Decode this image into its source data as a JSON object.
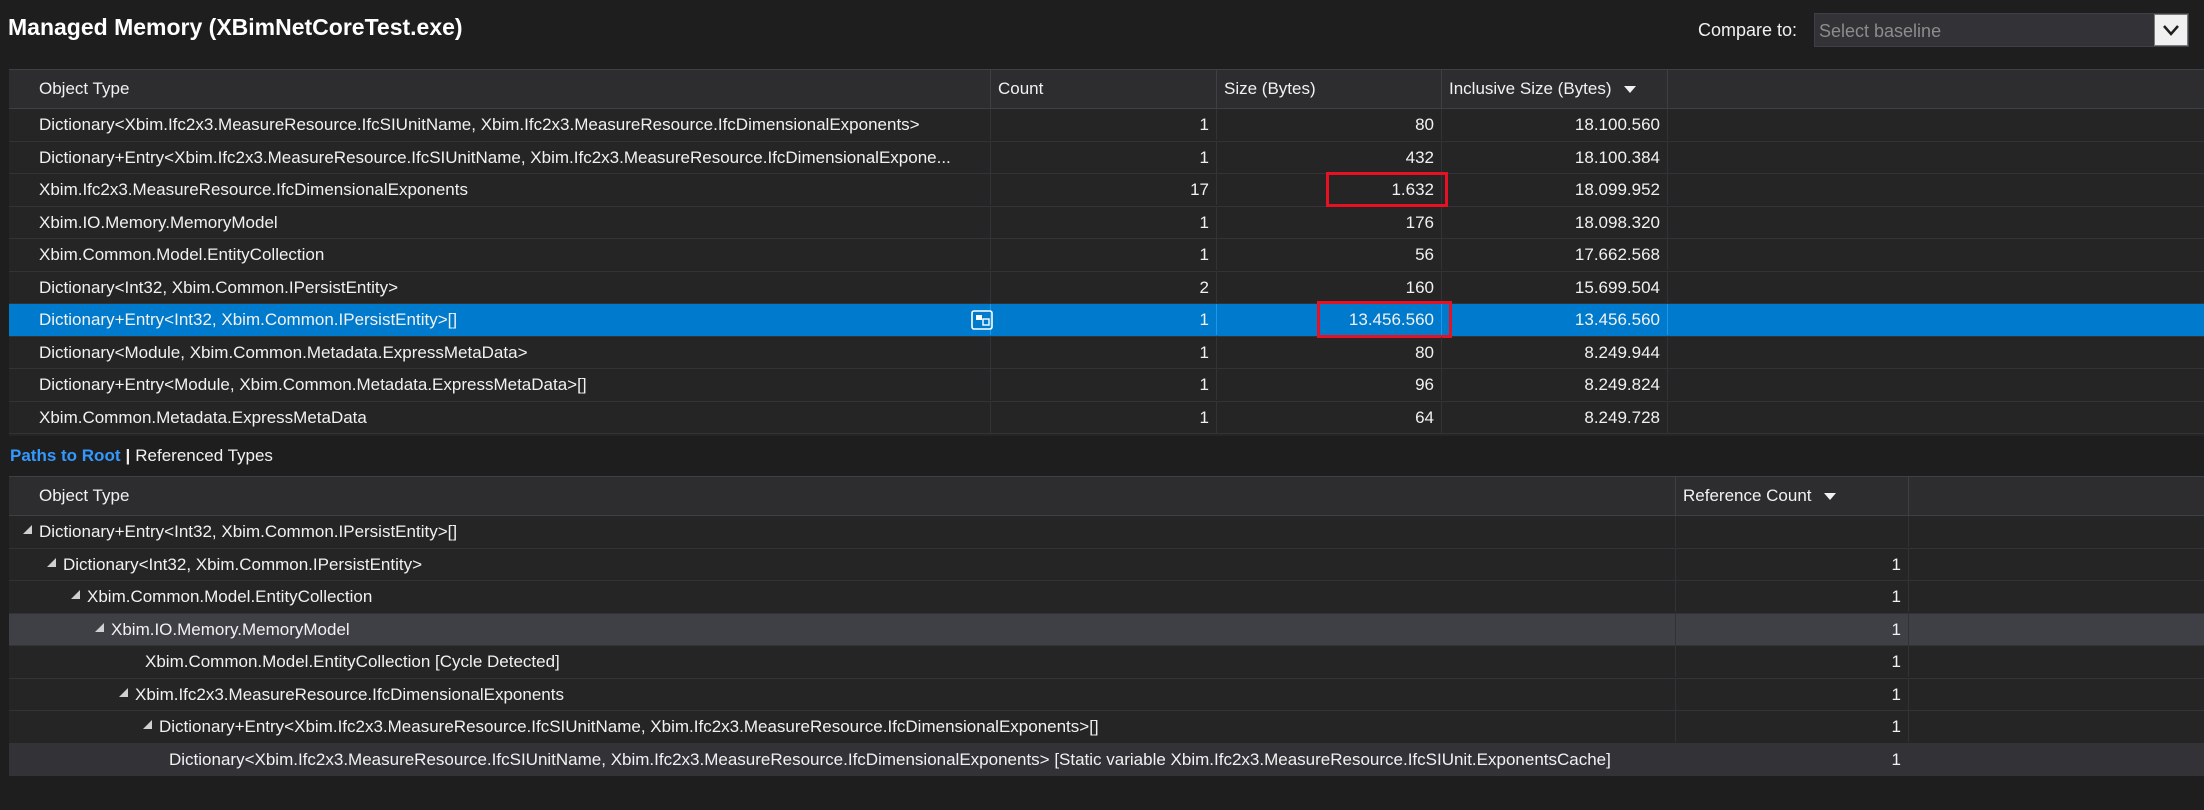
{
  "title": "Managed Memory (XBimNetCoreTest.exe)",
  "compare": {
    "label": "Compare to:",
    "placeholder": "Select baseline"
  },
  "top_table": {
    "headers": {
      "object_type": "Object Type",
      "count": "Count",
      "size": "Size (Bytes)",
      "inclusive": "Inclusive Size (Bytes)"
    },
    "rows": [
      {
        "type": "Dictionary<Xbim.Ifc2x3.MeasureResource.IfcSIUnitName, Xbim.Ifc2x3.MeasureResource.IfcDimensionalExponents>",
        "count": "1",
        "size": "80",
        "inclusive": "18.100.560"
      },
      {
        "type": "Dictionary+Entry<Xbim.Ifc2x3.MeasureResource.IfcSIUnitName, Xbim.Ifc2x3.MeasureResource.IfcDimensionalExpone...",
        "count": "1",
        "size": "432",
        "inclusive": "18.100.384"
      },
      {
        "type": "Xbim.Ifc2x3.MeasureResource.IfcDimensionalExponents",
        "count": "17",
        "size": "1.632",
        "inclusive": "18.099.952"
      },
      {
        "type": "Xbim.IO.Memory.MemoryModel",
        "count": "1",
        "size": "176",
        "inclusive": "18.098.320"
      },
      {
        "type": "Xbim.Common.Model.EntityCollection",
        "count": "1",
        "size": "56",
        "inclusive": "17.662.568"
      },
      {
        "type": "Dictionary<Int32, Xbim.Common.IPersistEntity>",
        "count": "2",
        "size": "160",
        "inclusive": "15.699.504"
      },
      {
        "type": "Dictionary+Entry<Int32, Xbim.Common.IPersistEntity>[]",
        "count": "1",
        "size": "13.456.560",
        "inclusive": "13.456.560"
      },
      {
        "type": "Dictionary<Module, Xbim.Common.Metadata.ExpressMetaData>",
        "count": "1",
        "size": "80",
        "inclusive": "8.249.944"
      },
      {
        "type": "Dictionary+Entry<Module, Xbim.Common.Metadata.ExpressMetaData>[]",
        "count": "1",
        "size": "96",
        "inclusive": "8.249.824"
      },
      {
        "type": "Xbim.Common.Metadata.ExpressMetaData",
        "count": "1",
        "size": "64",
        "inclusive": "8.249.728"
      }
    ]
  },
  "tabs": {
    "active": "Paths to Root",
    "separator": "|",
    "other": "Referenced Types"
  },
  "bottom_table": {
    "headers": {
      "object_type": "Object Type",
      "ref_count": "Reference Count"
    },
    "rows": [
      {
        "type": "Dictionary+Entry<Int32, Xbim.Common.IPersistEntity>[]",
        "ref": ""
      },
      {
        "type": "Dictionary<Int32, Xbim.Common.IPersistEntity>",
        "ref": "1"
      },
      {
        "type": "Xbim.Common.Model.EntityCollection",
        "ref": "1"
      },
      {
        "type": "Xbim.IO.Memory.MemoryModel",
        "ref": "1"
      },
      {
        "type": "Xbim.Common.Model.EntityCollection [Cycle Detected]",
        "ref": "1"
      },
      {
        "type": "Xbim.Ifc2x3.MeasureResource.IfcDimensionalExponents",
        "ref": "1"
      },
      {
        "type": "Dictionary+Entry<Xbim.Ifc2x3.MeasureResource.IfcSIUnitName, Xbim.Ifc2x3.MeasureResource.IfcDimensionalExponents>[]",
        "ref": "1"
      },
      {
        "type": "Dictionary<Xbim.Ifc2x3.MeasureResource.IfcSIUnitName, Xbim.Ifc2x3.MeasureResource.IfcDimensionalExponents> [Static variable Xbim.Ifc2x3.MeasureResource.IfcSIUnit.ExponentsCache]",
        "ref": "1"
      }
    ]
  }
}
